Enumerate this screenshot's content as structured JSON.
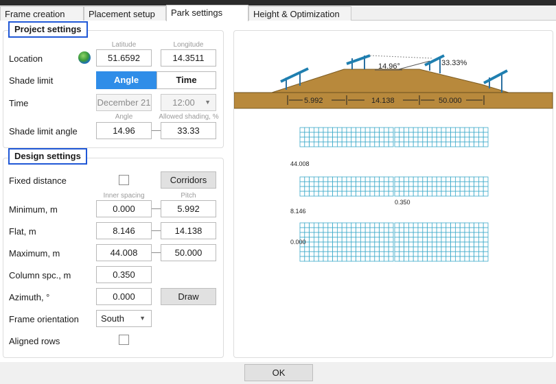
{
  "tabs": [
    "Frame creation",
    "Placement setup",
    "Park settings",
    "Height & Optimization"
  ],
  "project": {
    "title": "Project settings",
    "location_label": "Location",
    "latitude_hint": "Latitude",
    "longitude_hint": "Longitude",
    "latitude": "51.6592",
    "longitude": "14.3511",
    "shade_limit_label": "Shade limit",
    "angle_btn": "Angle",
    "time_btn": "Time",
    "time_label": "Time",
    "date": "December 21",
    "time_value": "12:00",
    "angle_hint": "Angle",
    "allowed_hint": "Allowed shading, %",
    "shade_angle_label": "Shade limit angle",
    "shade_angle": "14.96",
    "allowed_shading": "33.33"
  },
  "design": {
    "title": "Design settings",
    "fixed_distance_label": "Fixed distance",
    "corridors_btn": "Corridors",
    "inner_hint": "Inner spacing",
    "pitch_hint": "Pitch",
    "minimum_label": "Minimum, m",
    "minimum_inner": "0.000",
    "minimum_pitch": "5.992",
    "flat_label": "Flat, m",
    "flat_inner": "8.146",
    "flat_pitch": "14.138",
    "maximum_label": "Maximum, m",
    "maximum_inner": "44.008",
    "maximum_pitch": "50.000",
    "column_label": "Column spc., m",
    "column_value": "0.350",
    "azimuth_label": "Azimuth, °",
    "azimuth_value": "0.000",
    "draw_btn": "Draw",
    "orientation_label": "Frame orientation",
    "orientation_value": "South",
    "aligned_label": "Aligned rows"
  },
  "diagram": {
    "angle_label": "14.96°",
    "percent_label": "33.33%",
    "dim_left": "5.992",
    "dim_mid": "14.138",
    "dim_right": "50.000",
    "row_label_1": "44.008",
    "row_label_2": "0.350",
    "row_label_3": "8.146",
    "row_label_4": "0.000"
  },
  "ok_btn": "OK",
  "colors": {
    "accent": "#2f8de8",
    "section_border": "#1f57d6",
    "terrain": "#b8893c",
    "panel_grid": "#3aa9c9",
    "panel_pole": "#2a6fa0"
  }
}
